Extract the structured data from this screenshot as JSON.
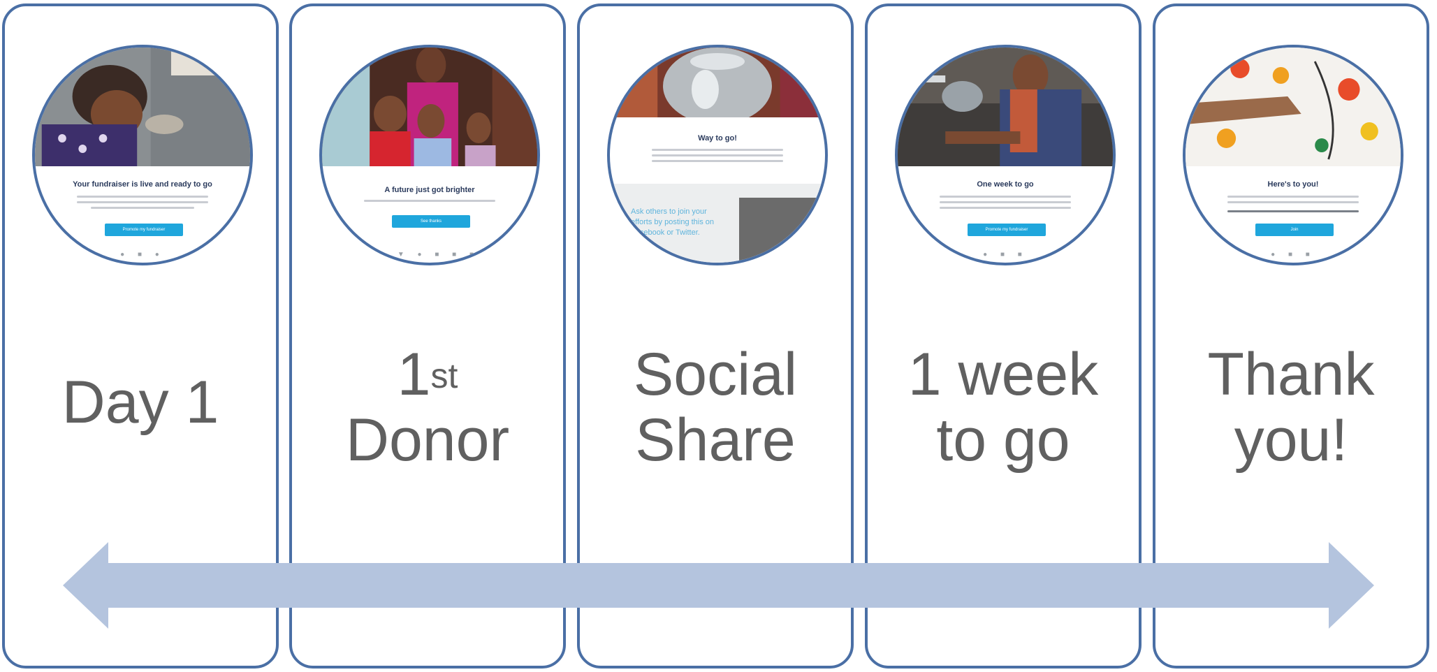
{
  "colors": {
    "card_border": "#4a6fa5",
    "arrow": "#b4c4de",
    "caption_text": "#606060",
    "email_button": "#1fa6dc"
  },
  "stages": [
    {
      "caption_line1": "Day 1",
      "caption_line2": "",
      "email_headline": "Your fundraiser is live and ready to go",
      "email_button": "Promote my fundraiser"
    },
    {
      "caption_line1": "1",
      "caption_sup": "st",
      "caption_line2": "Donor",
      "email_headline": "A future just got brighter",
      "email_button": "See thanks"
    },
    {
      "caption_line1": "Social",
      "caption_line2": "Share",
      "email_headline": "Way to go!",
      "email_side_text": "Ask others to join your efforts by posting this on Facebook or Twitter.",
      "email_button": ""
    },
    {
      "caption_line1": "1 week",
      "caption_line2": "to go",
      "email_headline": "One week to go",
      "email_button": "Promote my fundraiser"
    },
    {
      "caption_line1": "Thank",
      "caption_line2": "you!",
      "email_headline": "Here's to you!",
      "email_button": "Join"
    }
  ],
  "arrow": {
    "direction": "bidirectional"
  }
}
